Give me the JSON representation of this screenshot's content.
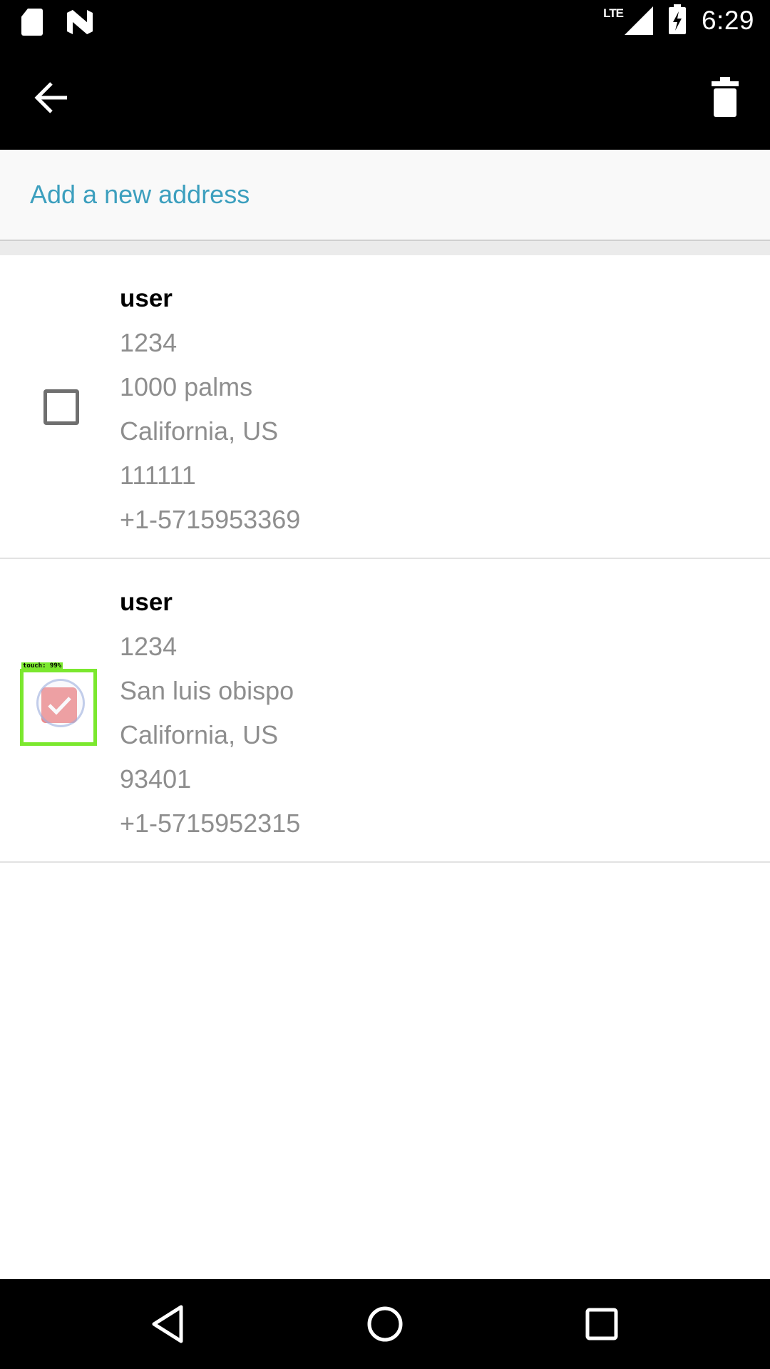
{
  "status_bar": {
    "time": "6:29",
    "network_label": "LTE",
    "icons": [
      "sd-card-icon",
      "n-notification-icon",
      "signal-icon",
      "battery-charging-icon"
    ]
  },
  "app_bar": {
    "back_icon": "arrow-back-icon",
    "delete_icon": "trash-icon"
  },
  "add_address": {
    "label": "Add a new address",
    "color": "#3c9fbe"
  },
  "addresses": [
    {
      "name": "user",
      "line1": "1234",
      "line2": "1000 palms",
      "line3": "California, US",
      "zip": "111111",
      "phone": "+1-5715953369",
      "checked": false
    },
    {
      "name": "user",
      "line1": "1234",
      "line2": "San luis obispo",
      "line3": "California, US",
      "zip": "93401",
      "phone": "+1-5715952315",
      "checked": true
    }
  ],
  "touch_overlay": {
    "label": "touch: 99%",
    "color": "#7be82e"
  },
  "nav_bar": {
    "icons": [
      "nav-back-icon",
      "nav-home-icon",
      "nav-recents-icon"
    ]
  }
}
